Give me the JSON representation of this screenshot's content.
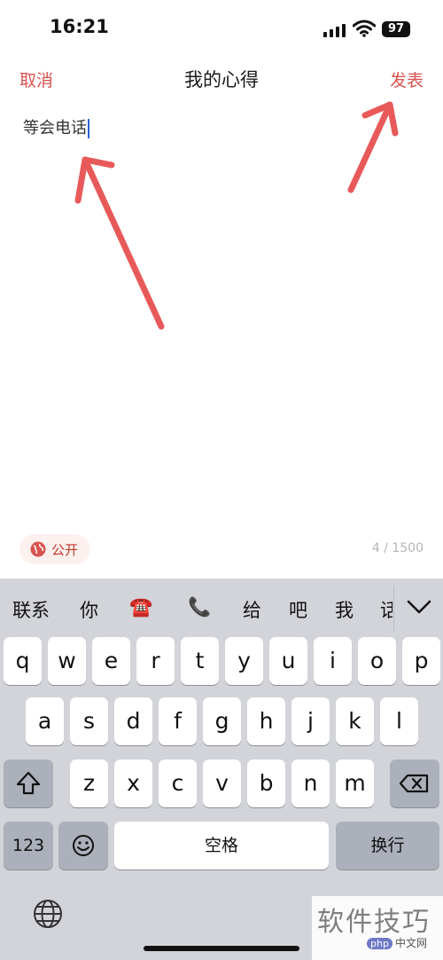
{
  "status_bar": {
    "time": "16:21",
    "battery": "97"
  },
  "nav": {
    "cancel": "取消",
    "title": "我的心得",
    "post": "发表"
  },
  "editor": {
    "text": "等会电话"
  },
  "footer": {
    "visibility": "公开",
    "counter": "4 / 1500"
  },
  "keyboard": {
    "candidates": [
      "联系",
      "你",
      "☎️",
      "📞",
      "给",
      "吧",
      "我",
      "话"
    ],
    "row1": [
      "q",
      "w",
      "e",
      "r",
      "t",
      "y",
      "u",
      "i",
      "o",
      "p"
    ],
    "row2": [
      "a",
      "s",
      "d",
      "f",
      "g",
      "h",
      "j",
      "k",
      "l"
    ],
    "row3": [
      "z",
      "x",
      "c",
      "v",
      "b",
      "n",
      "m"
    ],
    "numbers_key": "123",
    "space_key": "空格",
    "return_key": "换行"
  },
  "watermark": {
    "text": "软件技巧",
    "logo": "php",
    "logo_suffix": "中文网"
  },
  "colors": {
    "accent": "#d9534f",
    "arrow": "#e85a5a",
    "keyboard_bg": "#d2d4d9"
  }
}
